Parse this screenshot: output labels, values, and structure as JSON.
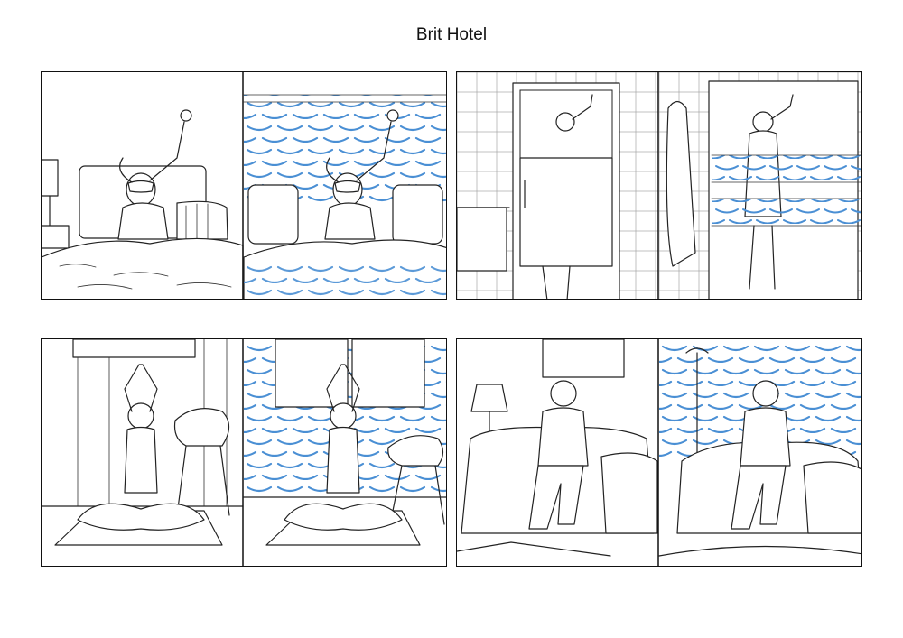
{
  "page": {
    "title": "Brit Hotel"
  },
  "colors": {
    "wave_pattern": "#4a8fd4",
    "line_art": "#222222",
    "background": "#ffffff"
  },
  "boards": [
    {
      "name": "waking-stretch",
      "panels": [
        "sketch-plain",
        "sketch-wave-pattern"
      ]
    },
    {
      "name": "shower",
      "panels": [
        "sketch-plain",
        "sketch-wave-pattern"
      ]
    },
    {
      "name": "yoga",
      "panels": [
        "sketch-plain",
        "sketch-wave-pattern"
      ]
    },
    {
      "name": "sofa-coffee",
      "panels": [
        "sketch-plain",
        "sketch-wave-pattern"
      ]
    }
  ]
}
